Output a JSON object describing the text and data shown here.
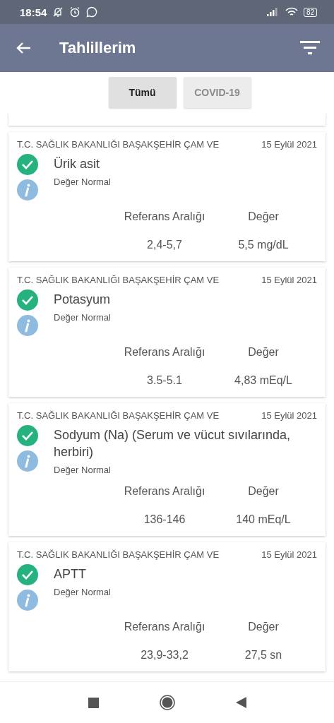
{
  "status_bar": {
    "time": "18:54",
    "battery": "82"
  },
  "app_bar": {
    "title": "Tahlillerim"
  },
  "tabs": [
    {
      "label": "Tümü",
      "selected": true
    },
    {
      "label": "COVID-19",
      "selected": false
    }
  ],
  "results": [
    {
      "institution": "T.C. SAĞLIK BAKANLIĞI BAŞAKŞEHİR ÇAM VE",
      "date": "15 Eylül 2021",
      "test": "Ürik asit",
      "status": "Değer Normal",
      "reference_header": "Referans Aralığı",
      "value_header": "Değer",
      "reference": "2,4-5,7",
      "value": "5,5 mg/dL"
    },
    {
      "institution": "T.C. SAĞLIK BAKANLIĞI BAŞAKŞEHİR ÇAM VE",
      "date": "15 Eylül 2021",
      "test": "Potasyum",
      "status": "Değer Normal",
      "reference_header": "Referans Aralığı",
      "value_header": "Değer",
      "reference": "3.5-5.1",
      "value": "4,83 mEq/L"
    },
    {
      "institution": "T.C. SAĞLIK BAKANLIĞI BAŞAKŞEHİR ÇAM VE",
      "date": "15 Eylül 2021",
      "test": "Sodyum (Na) (Serum ve vücut sıvılarında, herbiri)",
      "status": "Değer Normal",
      "reference_header": "Referans Aralığı",
      "value_header": "Değer",
      "reference": "136-146",
      "value": "140 mEq/L"
    },
    {
      "institution": "T.C. SAĞLIK BAKANLIĞI BAŞAKŞEHİR ÇAM VE",
      "date": "15 Eylül 2021",
      "test": "APTT",
      "status": "Değer Normal",
      "reference_header": "Referans Aralığı",
      "value_header": "Değer",
      "reference": "23,9-33,2",
      "value": "27,5 sn"
    }
  ]
}
